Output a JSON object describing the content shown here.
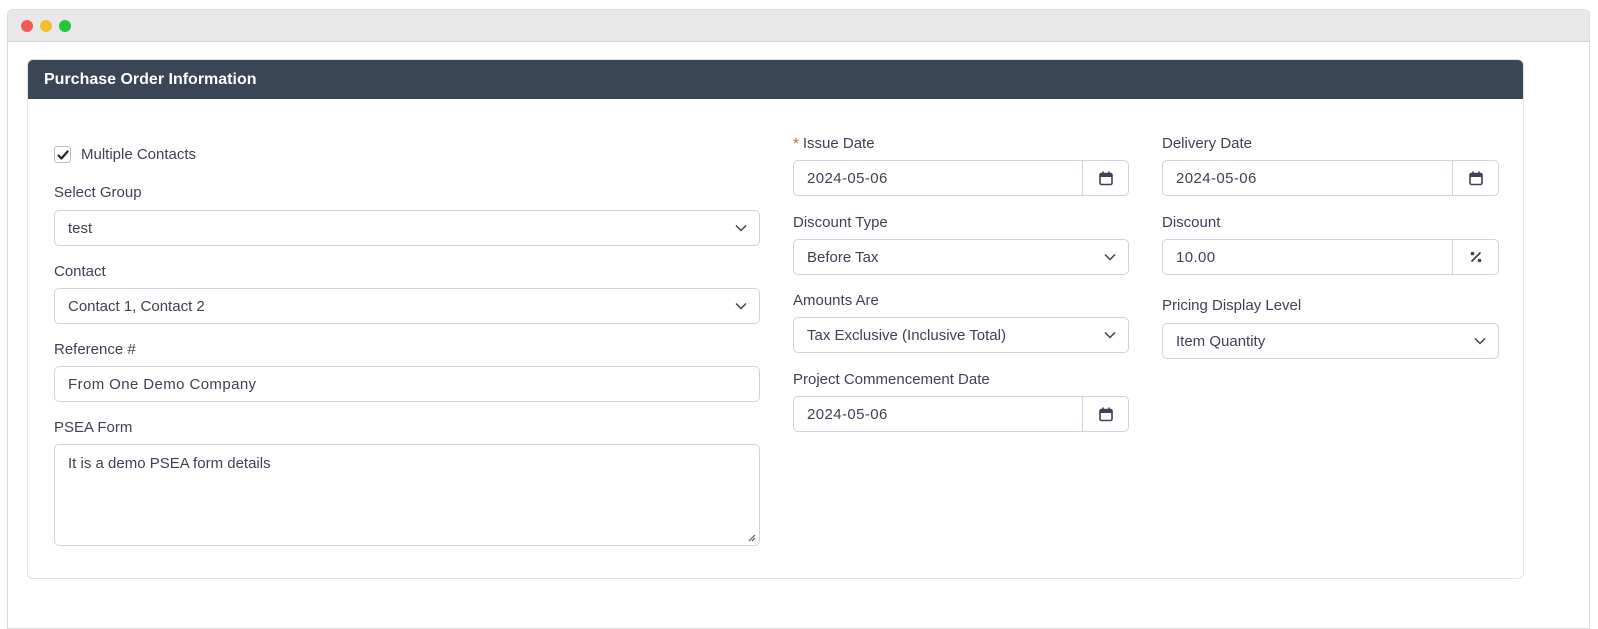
{
  "header": {
    "title": "Purchase Order Information"
  },
  "left": {
    "multiple_contacts": {
      "label": "Multiple Contacts",
      "checked": true
    },
    "select_group": {
      "label": "Select Group",
      "value": "test"
    },
    "contact": {
      "label": "Contact",
      "value": "Contact 1, Contact 2"
    },
    "reference": {
      "label": "Reference #",
      "value": "From One Demo Company"
    },
    "psea": {
      "label": "PSEA Form",
      "value": "It is a demo PSEA form details"
    }
  },
  "middle": {
    "issue_date": {
      "required_mark": "*",
      "label": "Issue Date",
      "value": "2024-05-06"
    },
    "discount_type": {
      "label": "Discount Type",
      "value": "Before Tax"
    },
    "amounts_are": {
      "label": "Amounts Are",
      "value": "Tax Exclusive (Inclusive Total)"
    },
    "project_commencement": {
      "label": "Project Commencement Date",
      "value": "2024-05-06"
    }
  },
  "right": {
    "delivery_date": {
      "label": "Delivery Date",
      "value": "2024-05-06"
    },
    "discount": {
      "label": "Discount",
      "value": "10.00"
    },
    "pricing_display": {
      "label": "Pricing Display Level",
      "value": "Item Quantity"
    }
  },
  "icons": {
    "calendar": "calendar-icon",
    "chevron": "chevron-down-icon",
    "percent": "percent-icon",
    "check": "check-icon"
  },
  "colors": {
    "header_bg": "#3a4556",
    "required": "#e5533d",
    "border": "#cdd3e0"
  }
}
